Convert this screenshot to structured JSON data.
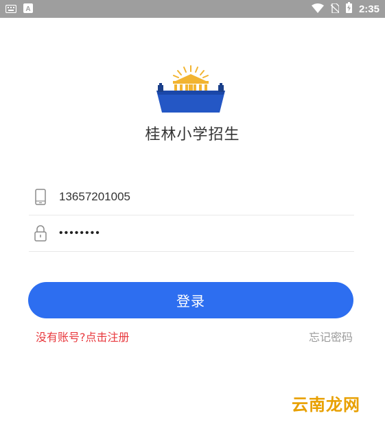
{
  "status_bar": {
    "time": "2:35",
    "icons": [
      "keyboard-icon",
      "notification-a-icon",
      "wifi-icon",
      "no-sim-icon",
      "battery-icon"
    ]
  },
  "app": {
    "title": "桂林小学招生"
  },
  "form": {
    "phone_value": "13657201005",
    "password_value": "••••••••"
  },
  "actions": {
    "login_label": "登录",
    "register_label": "没有账号?点击注册",
    "forgot_label": "忘记密码"
  },
  "watermark": {
    "text": "云南龙网"
  },
  "colors": {
    "primary": "#2d6ef0",
    "register_text": "#e8383d",
    "muted_text": "#9a9a9a",
    "status_bar": "#9e9e9e",
    "logo_gold": "#f2b431",
    "logo_blue": "#2457c5"
  }
}
